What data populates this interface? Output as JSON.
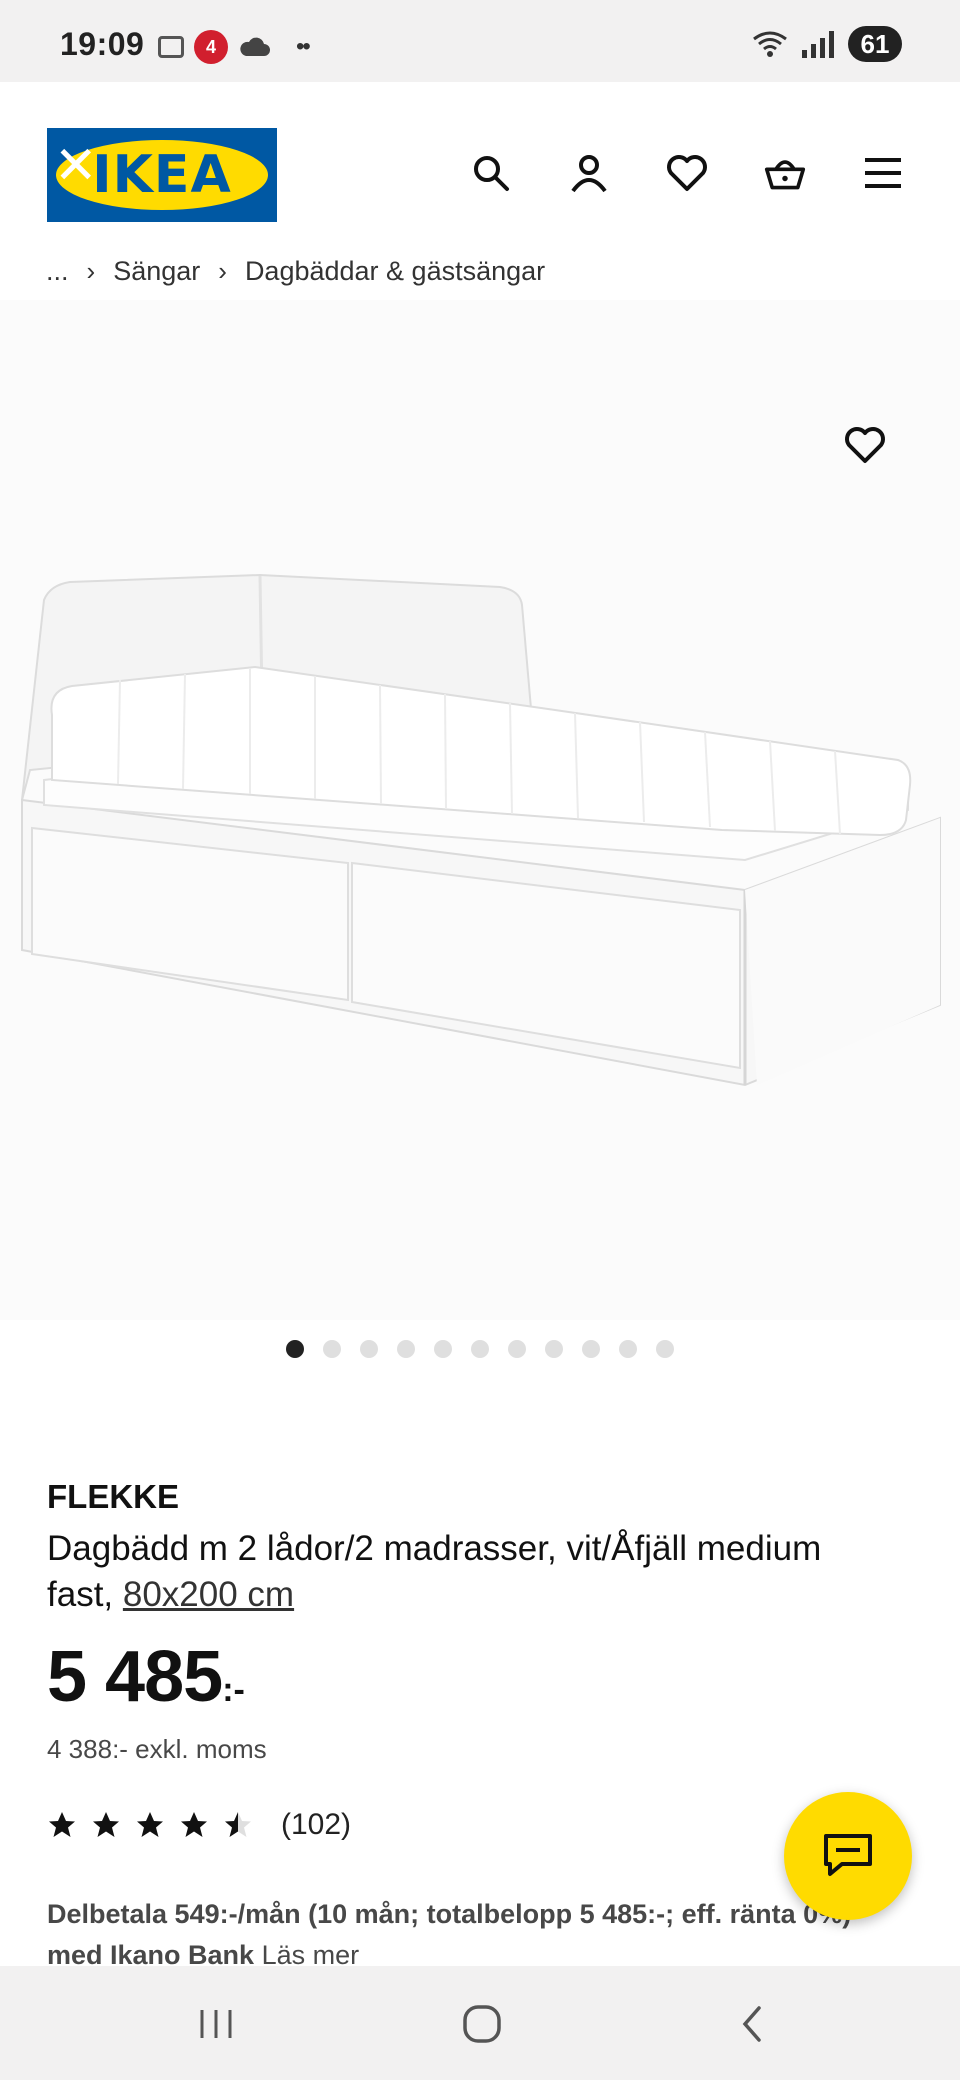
{
  "status_bar": {
    "time": "19:09",
    "notification_badge": "4",
    "battery": "61",
    "icons": [
      "gallery-icon",
      "youtube-badge-icon",
      "cloud-icon",
      "more-dots-icon",
      "wifi-icon",
      "signal-icon",
      "battery-icon"
    ]
  },
  "header": {
    "logo_text": "IKEA",
    "icons": [
      "search-icon",
      "account-icon",
      "wishlist-heart-icon",
      "cart-basket-icon",
      "menu-hamburger-icon"
    ]
  },
  "breadcrumb": {
    "items": [
      "...",
      "Sängar",
      "Dagbäddar & gästsängar"
    ]
  },
  "gallery": {
    "image_alt": "Vit dagbädd med två lådor och madrasser",
    "total_images": 11,
    "active_index": 0
  },
  "product": {
    "name": "FLEKKE",
    "description": "Dagbädd m 2 lådor/2 madrasser, vit/Åfjäll medium fast,",
    "size": "80x200 cm",
    "price": "5 485",
    "price_suffix": ":-",
    "price_ex_vat": "4 388:- exkl. moms",
    "rating": 4.5,
    "rating_max": 5,
    "review_count": "(102)",
    "installment_text": "Delbetala 549:-/mån (10 mån; totalbelopp 5 485:-; eff. ränta 0%) med Ikano Bank",
    "installment_link": "Läs mer"
  },
  "colors": {
    "ikea_blue": "#0058a3",
    "ikea_yellow": "#ffdb00",
    "badge_red": "#d11f2e"
  }
}
